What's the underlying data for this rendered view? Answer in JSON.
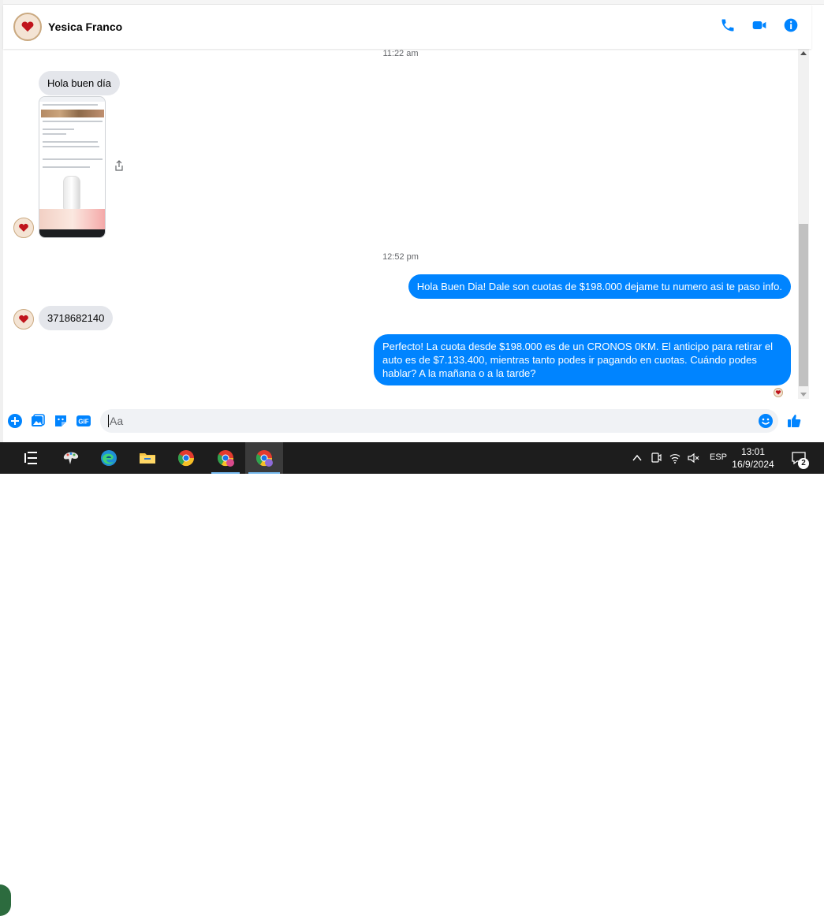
{
  "header": {
    "contact_name": "Yesica Franco",
    "icons": [
      "phone-icon",
      "video-call-icon",
      "info-icon"
    ]
  },
  "conversation": {
    "timestamp_1": "11:22 am",
    "msg_1": "Hola buen día",
    "timestamp_2": "12:52 pm",
    "msg_2": "Hola Buen Dia! Dale son cuotas de $198.000 dejame tu numero asi te paso info.",
    "msg_3": "3718682140",
    "msg_4": "Perfecto! La cuota desde $198.000 es de un CRONOS 0KM. El anticipo para retirar el auto es de $7.133.400, mientras tanto podes ir pagando en cuotas. Cuándo podes hablar? A la mañana o a la tarde?"
  },
  "composer": {
    "placeholder": "Aa",
    "icons": [
      "plus-icon",
      "photo-icon",
      "sticker-icon",
      "gif-icon",
      "emoji-icon",
      "like-icon"
    ],
    "gif_label": "GIF"
  },
  "taskbar": {
    "lang": "ESP",
    "time": "13:01",
    "date": "16/9/2024",
    "notification_count": "2"
  },
  "colors": {
    "accent": "#0084ff",
    "incoming_bubble": "#e4e6eb",
    "taskbar": "#1d1d1d"
  }
}
